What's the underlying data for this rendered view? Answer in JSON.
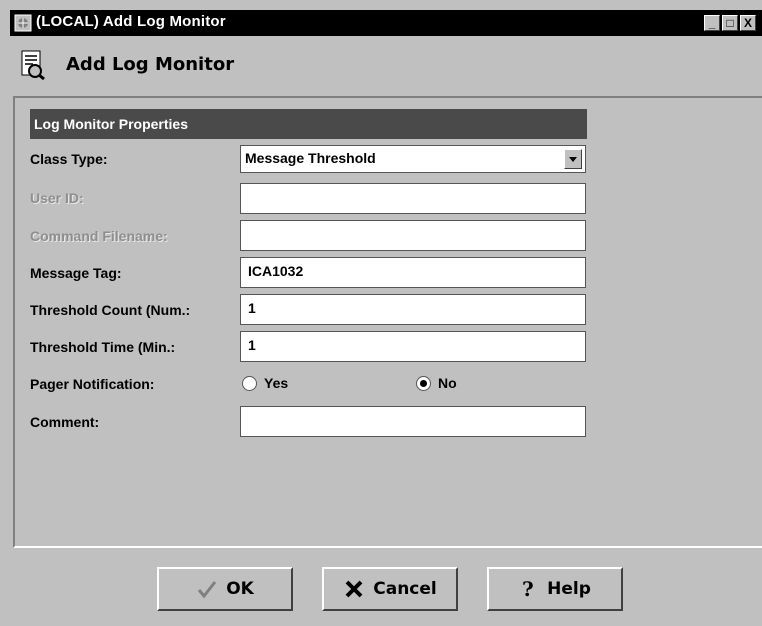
{
  "window": {
    "title": "(LOCAL) Add Log Monitor",
    "controls": [
      "_",
      "□",
      "X"
    ]
  },
  "header": {
    "title": "Add Log Monitor",
    "icon": "log-document-icon"
  },
  "group": {
    "title": "Log Monitor Properties"
  },
  "fields": {
    "class_type": {
      "label": "Class Type:",
      "value": "Message Threshold"
    },
    "user_id": {
      "label": "User ID:",
      "value": ""
    },
    "command_filename": {
      "label": "Command Filename:",
      "value": ""
    },
    "message_tag": {
      "label": "Message Tag:",
      "value": "ICA1032"
    },
    "threshold_count": {
      "label": "Threshold Count (Num.:",
      "value": "1"
    },
    "threshold_time": {
      "label": "Threshold Time (Min.:",
      "value": "1"
    },
    "pager_notification": {
      "label": "Pager Notification:",
      "options": [
        "Yes",
        "No"
      ],
      "selected": "No"
    },
    "comment": {
      "label": "Comment:",
      "value": ""
    }
  },
  "buttons": {
    "ok": "OK",
    "cancel": "Cancel",
    "help": "Help"
  }
}
